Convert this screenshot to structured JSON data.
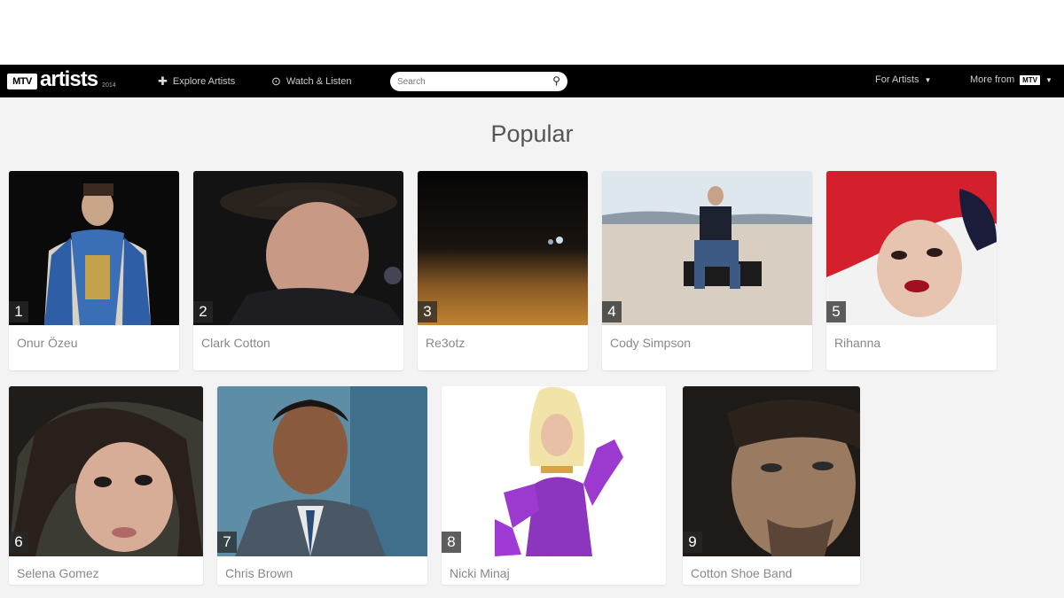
{
  "header": {
    "logo_mark": "MTV",
    "logo_text": "artists",
    "logo_year": "2014",
    "explore_label": "Explore Artists",
    "watch_label": "Watch & Listen",
    "search_placeholder": "Search",
    "for_artists_label": "For Artists",
    "more_from_label": "More from",
    "more_from_brand": "MTV"
  },
  "main": {
    "title": "Popular"
  },
  "artists": [
    {
      "rank": "1",
      "name": "Onur Özeu"
    },
    {
      "rank": "2",
      "name": "Clark Cotton"
    },
    {
      "rank": "3",
      "name": "Re3otz"
    },
    {
      "rank": "4",
      "name": "Cody Simpson"
    },
    {
      "rank": "5",
      "name": "Rihanna"
    },
    {
      "rank": "6",
      "name": "Selena Gomez"
    },
    {
      "rank": "7",
      "name": "Chris Brown"
    },
    {
      "rank": "8",
      "name": "Nicki Minaj"
    },
    {
      "rank": "9",
      "name": "Cotton Shoe Band"
    }
  ],
  "colors": {
    "nav_bg": "#000000",
    "page_bg": "#f3f3f3",
    "card_bg": "#ffffff"
  }
}
